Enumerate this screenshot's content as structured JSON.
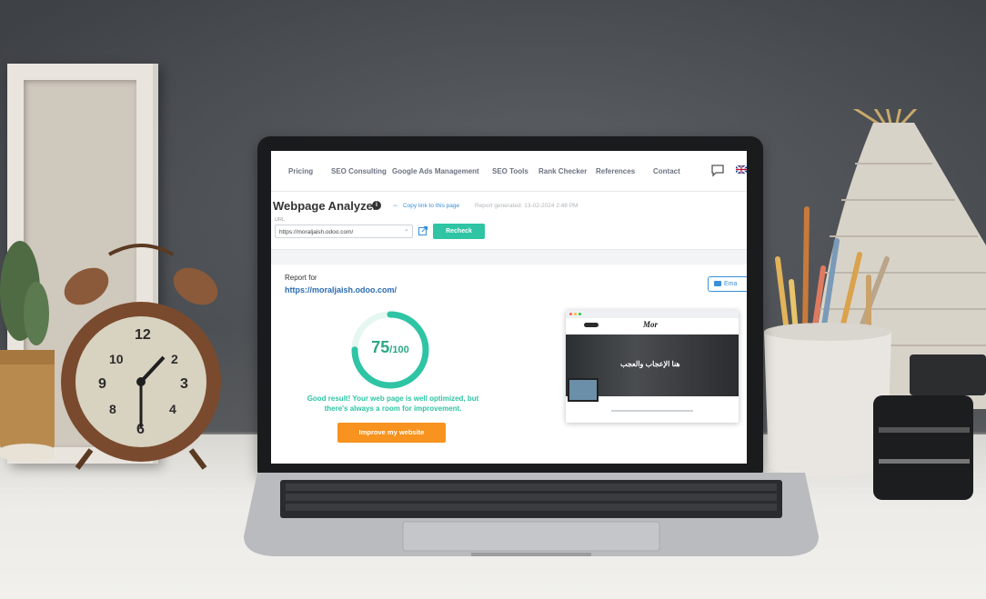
{
  "nav": {
    "items": [
      "Pricing",
      "SEO Consulting",
      "Google Ads Management",
      "SEO Tools",
      "Rank Checker",
      "References",
      "Contact"
    ]
  },
  "header": {
    "title": "Webpage Analyzer",
    "copy_link": "Copy link to this page",
    "report_generated": "Report generated: 13-02-2024 2:48 PM"
  },
  "url_form": {
    "label": "URL",
    "value": "https://moraljaish.odoo.com/",
    "recheck_label": "Recheck"
  },
  "report": {
    "report_for_label": "Report for",
    "url": "https://moraljaish.odoo.com/",
    "score": "75",
    "score_max": "/100",
    "score_fraction": 0.75,
    "result_line1": "Good result! Your web page is well optimized, but",
    "result_line2": "there's always a room for improvement.",
    "improve_label": "Improve my website",
    "email_label": "Ema"
  },
  "preview": {
    "logo": "Mor",
    "hero_text": "هنا الإعجاب والعجب"
  },
  "colors": {
    "accent_green": "#2ec4a4",
    "accent_orange": "#f7931e",
    "link_blue": "#2b6cb0"
  }
}
